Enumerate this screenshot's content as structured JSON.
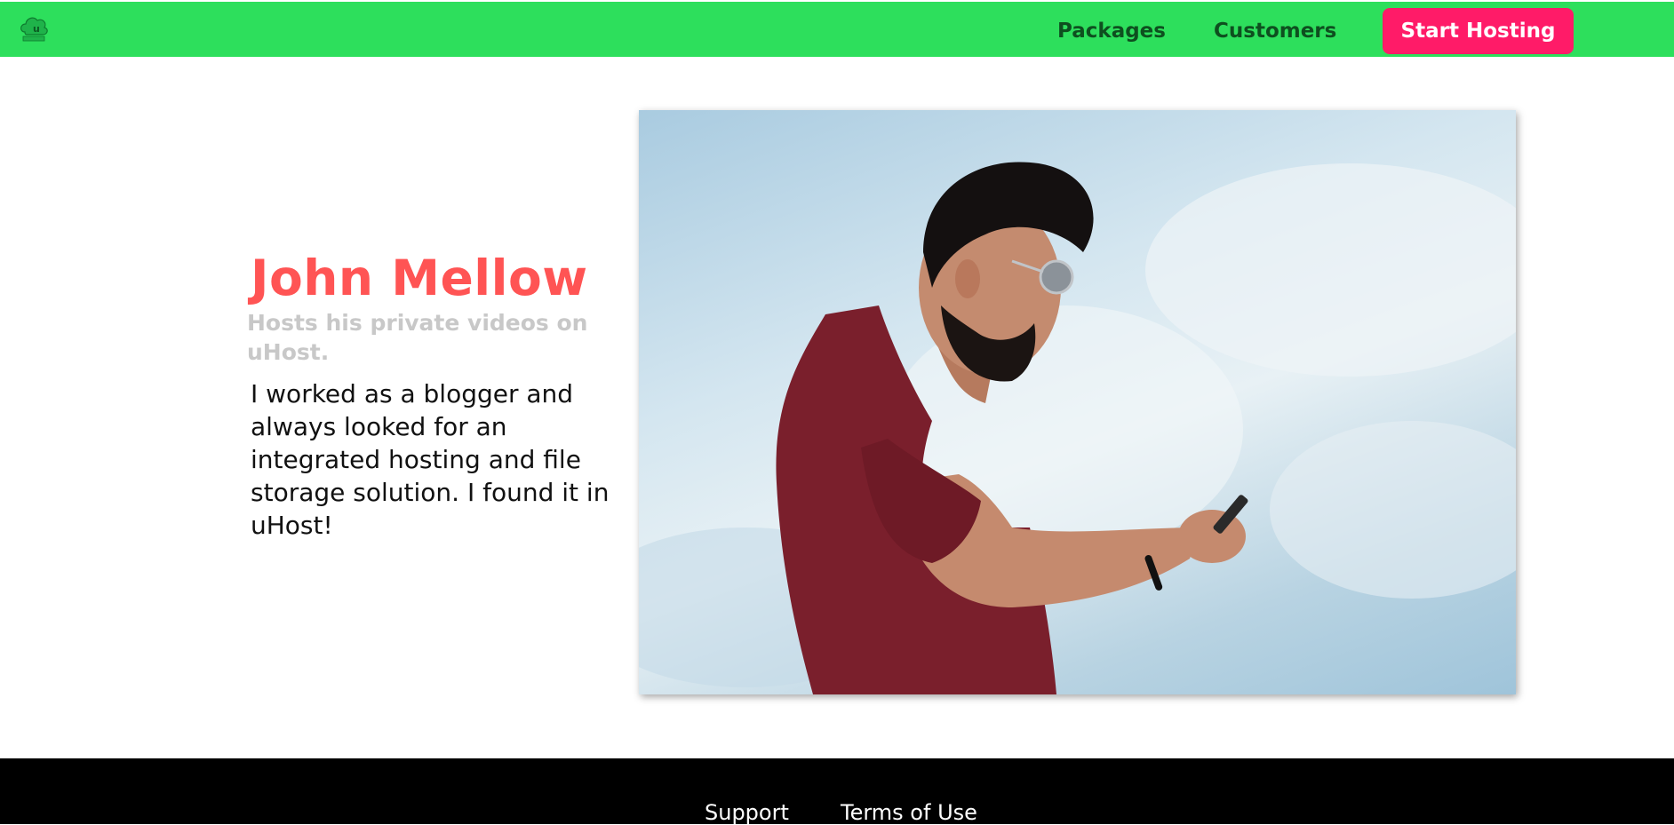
{
  "header": {
    "brand_icon": "uhost-logo-icon",
    "nav": {
      "packages_label": "Packages",
      "customers_label": "Customers"
    },
    "cta_label": "Start Hosting"
  },
  "testimonial": {
    "name": "John Mellow",
    "subtitle": "Hosts his private videos on uHost.",
    "quote": "I worked as a blogger and always looked for an integrated hosting and file storage solution. I found it in uHost!",
    "image_alt": "man-looking-at-phone-photo"
  },
  "footer": {
    "support_label": "Support",
    "terms_label": "Terms of Use"
  },
  "colors": {
    "header_bg": "#2ddf5c",
    "nav_text": "#0e4f1f",
    "cta_bg": "#ff1b68",
    "name_color": "#ff5454",
    "subtitle_color": "#c8c8c8",
    "footer_bg": "#000000"
  }
}
